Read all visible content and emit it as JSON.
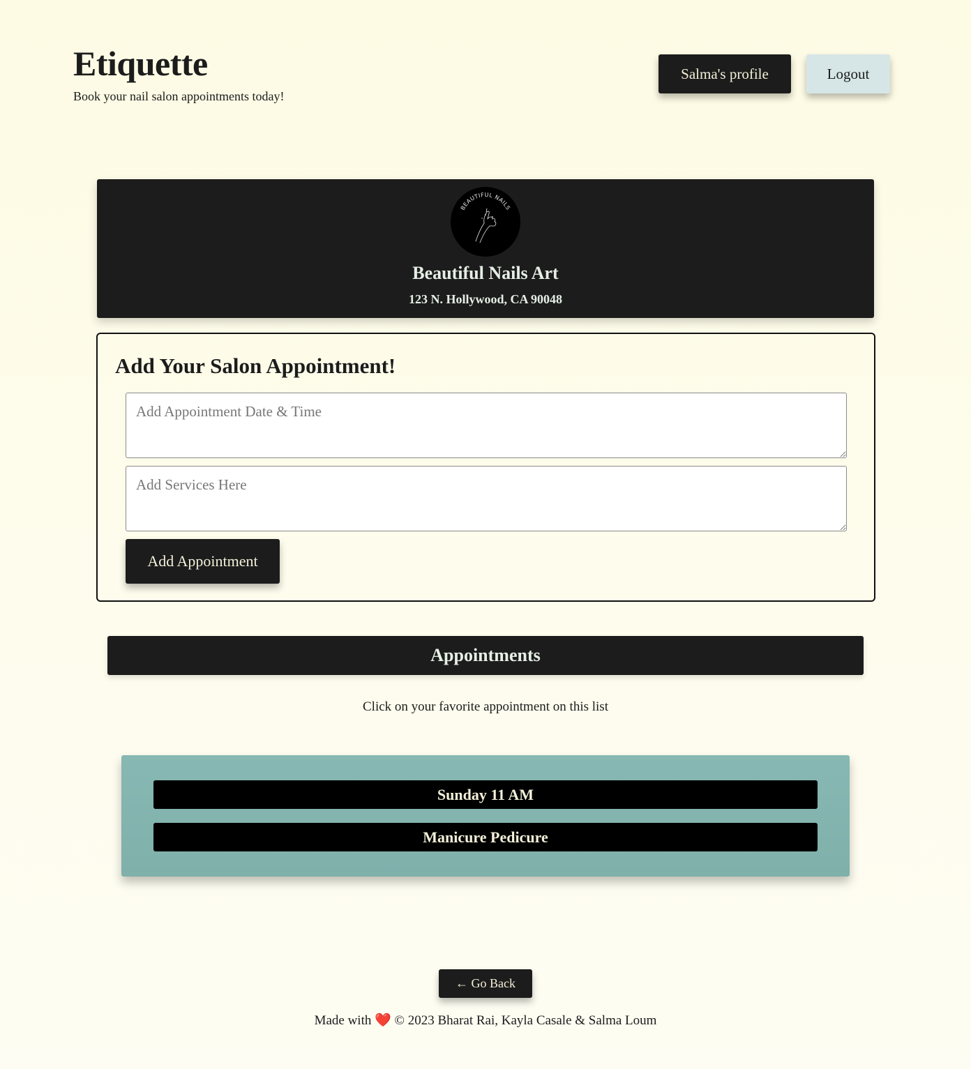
{
  "header": {
    "title": "Etiquette",
    "tagline": "Book your nail salon appointments today!",
    "profile_label": "Salma's profile",
    "logout_label": "Logout"
  },
  "salon": {
    "logo_text": "BEAUTIFUL NAILS",
    "name": "Beautiful Nails Art",
    "address": "123 N. Hollywood, CA 90048"
  },
  "form": {
    "title": "Add Your Salon Appointment!",
    "date_placeholder": "Add Appointment Date & Time",
    "date_value": "",
    "services_placeholder": "Add Services Here",
    "services_value": "",
    "submit_label": "Add Appointment"
  },
  "appointments": {
    "title": "Appointments",
    "hint": "Click on your favorite appointment on this list",
    "items": [
      {
        "time": "Sunday 11 AM",
        "services": "Manicure Pedicure"
      }
    ]
  },
  "footer": {
    "back_label": "← Go Back",
    "made_with": "Made with",
    "heart": "❤️",
    "credits": "© 2023 Bharat Rai, Kayla Casale & Salma Loum"
  },
  "colors": {
    "background": "#fdfbe4",
    "dark": "#1c1c1c",
    "accent_light": "#d6e6e6",
    "appointment_card": "#87b8b3"
  }
}
